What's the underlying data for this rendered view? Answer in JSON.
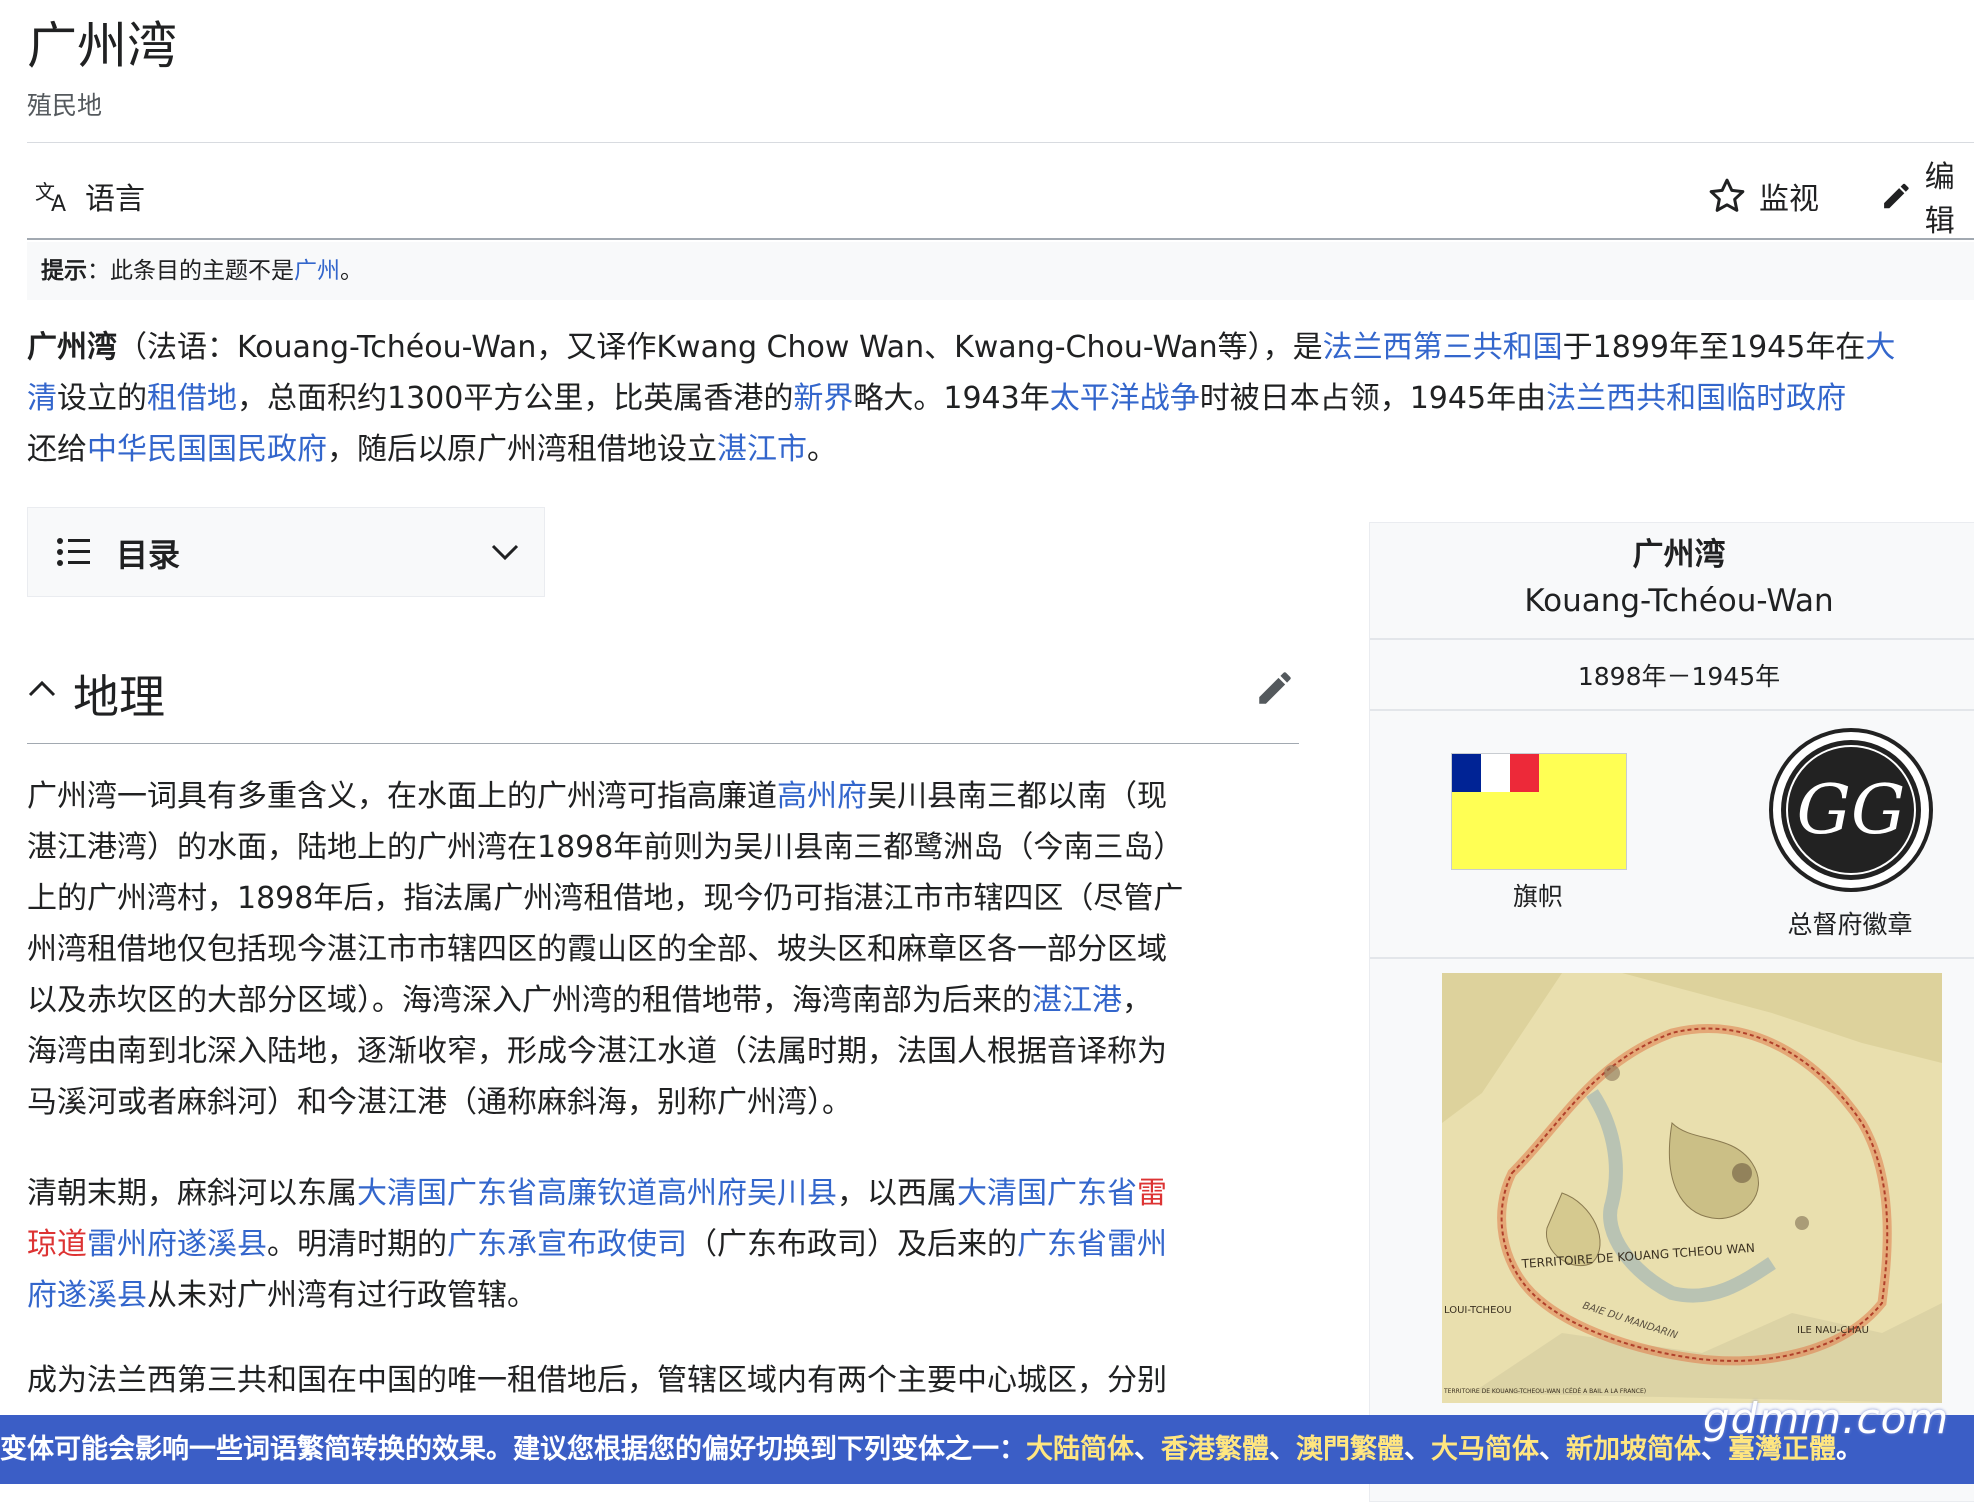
{
  "page": {
    "title": "广州湾",
    "subtitle": "殖民地"
  },
  "toolbar": {
    "language_label": "语言",
    "watch_label": "监视",
    "edit_label": "编辑"
  },
  "hatnote": {
    "prefix": "提示",
    "colon": "：此条目的主题不是",
    "link": "广州",
    "suffix": "。"
  },
  "intro": {
    "l1_bold": "广州湾",
    "l1_a": "（法语：Kouang-Tchéou-Wan，又译作Kwang Chow Wan、Kwang-Chou-Wan等），是",
    "l1_link1": "法兰西第三共和国",
    "l1_b": "于1899年至1945年在",
    "l1_link2": "大",
    "l2_link1": "清",
    "l2_a": "设立的",
    "l2_link2": "租借地",
    "l2_b": "，总面积约1300平方公里，比英属香港的",
    "l2_link3": "新界",
    "l2_c": "略大。1943年",
    "l2_link4": "太平洋战争",
    "l2_d": "时被日本占领，1945年由",
    "l2_link5": "法兰西共和国临时政府",
    "l3_a": "还给",
    "l3_link1": "中华民国国民政府",
    "l3_b": "，随后以原广州湾租借地设立",
    "l3_link2": "湛江市",
    "l3_c": "。"
  },
  "toc": {
    "label": "目录"
  },
  "section": {
    "heading": "地理"
  },
  "geo_p1": {
    "l1_a": "广州湾一词具有多重含义，在水面上的广州湾可指高廉道",
    "l1_link": "高州府",
    "l1_b": "吴川县南三都以南（现",
    "l2": "湛江港湾）的水面，陆地上的广州湾在1898年前则为吴川县南三都鹭洲岛（今南三岛）",
    "l3": "上的广州湾村，1898年后，指法属广州湾租借地，现今仍可指湛江市市辖四区（尽管广",
    "l4": "州湾租借地仅包括现今湛江市市辖四区的霞山区的全部、坡头区和麻章区各一部分区域",
    "l5_a": "以及赤坎区的大部分区域）。海湾深入广州湾的租借地带，海湾南部为后来的",
    "l5_link": "湛江港",
    "l5_b": "，",
    "l6": "海湾由南到北深入陆地，逐渐收窄，形成今湛江水道（法属时期，法国人根据音译称为",
    "l7": "马溪河或者麻斜河）和今湛江港（通称麻斜海，别称广州湾）。"
  },
  "geo_p2": {
    "l1_a": "清朝末期，麻斜河以东属",
    "l1_link1": "大清国广东省高廉钦道高州府吴川县",
    "l1_b": "，以西属",
    "l1_link2": "大清国广东省",
    "l1_red": "雷",
    "l2_red": "琼道",
    "l2_link1": "雷州府遂溪县",
    "l2_a": "。明清时期的",
    "l2_link2": "广东承宣布政使司",
    "l2_b": "（广东布政司）及后来的",
    "l2_link3": "广东省雷州",
    "l3_link": "府遂溪县",
    "l3_a": "从未对广州湾有过行政管辖。"
  },
  "geo_p3": {
    "l1": "成为法兰西第三共和国在中国的唯一租借地后，管辖区域内有两个主要中心城区，分别"
  },
  "infobox": {
    "title_zh": "广州湾",
    "title_fr": "Kouang-Tchéou-Wan",
    "years": "1898年－1945年",
    "flag_caption": "旗帜",
    "emblem_caption": "总督府徽章",
    "emblem_letters": "GG",
    "map_label": "TERRITOIRE DE KOUANG TCHEOU WAN",
    "map_place1": "LOUI-TCHEOU",
    "map_place2": "ILE NAU-CHAU",
    "map_place3": "BAIE DU MANDARIN",
    "map_note": "TERRITOIRE DE KOUANG-TCHEOU-WAN (CÉDÉ A BAIL A LA FRANCE)"
  },
  "banner": {
    "text": "变体可能会影响一些词语繁简转换的效果。建议您根据您的偏好切换到下列变体之一：",
    "v1": "大陆简体",
    "v2": "香港繁體",
    "v3": "澳門繁體",
    "v4": "大马简体",
    "v5": "新加坡简体",
    "v6": "臺灣正體",
    "sep": "、",
    "end": "。"
  },
  "watermark": "gdmm.com",
  "colors": {
    "link": "#3366cc",
    "redlink": "#d33",
    "banner_bg": "#3b5ec6",
    "banner_link": "#ffe680",
    "flag_yellow": "#ffff54",
    "flag_blue": "#002395",
    "flag_red": "#ed2939"
  }
}
